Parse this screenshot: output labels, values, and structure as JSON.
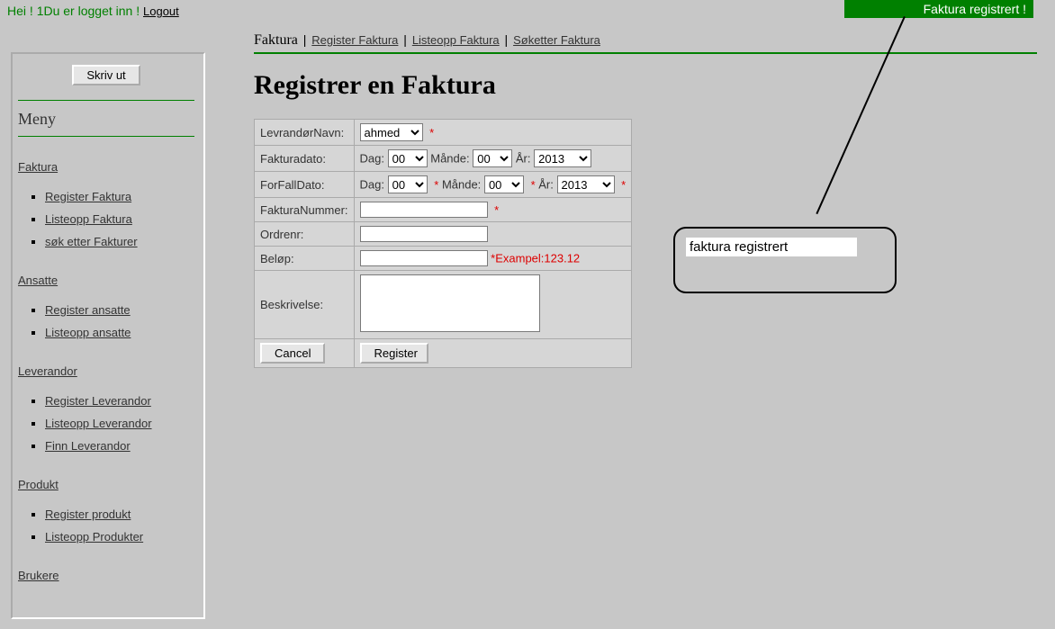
{
  "top": {
    "greet_prefix": "Hei ! ",
    "greet_user": "1",
    "greet_suffix": "Du er logget inn ! ",
    "logout": "Logout"
  },
  "banner": "Faktura registrert !",
  "sidebar": {
    "print": "Skriv ut",
    "menu_header": "Meny",
    "faktura": {
      "title": "Faktura",
      "items": [
        "Register Faktura",
        "Listeopp Faktura",
        "søk etter Fakturer"
      ]
    },
    "ansatte": {
      "title": "Ansatte",
      "items": [
        "Register ansatte",
        "Listeopp ansatte"
      ]
    },
    "leverandor": {
      "title": "Leverandor",
      "items": [
        "Register Leverandor",
        "Listeopp Leverandor",
        "Finn Leverandor"
      ]
    },
    "produkt": {
      "title": "Produkt",
      "items": [
        "Register produkt",
        "Listeopp Produkter"
      ]
    },
    "brukere": {
      "title": "Brukere"
    }
  },
  "breadcrumb": {
    "current": "Faktura",
    "links": [
      "Register Faktura",
      "Listeopp Faktura",
      "Søketter Faktura"
    ]
  },
  "page_title": "Registrer en Faktura",
  "form": {
    "labels": {
      "lev": "LevrandørNavn:",
      "fdato": "Fakturadato:",
      "ffdato": "ForFallDato:",
      "fnum": "FakturaNummer:",
      "ordre": "Ordrenr:",
      "belop": "Beløp:",
      "besk": "Beskrivelse:"
    },
    "sub": {
      "dag": "Dag:",
      "mande": "Månde:",
      "ar": "År:"
    },
    "values": {
      "lev": "ahmed",
      "dag1": "00",
      "mnd1": "00",
      "ar1": "2013",
      "dag2": "00",
      "mnd2": "00",
      "ar2": "2013",
      "fnum": "",
      "ordre": "",
      "belop": "",
      "besk": ""
    },
    "example": "*Exampel:123.12",
    "asterisk": "*",
    "buttons": {
      "cancel": "Cancel",
      "register": "Register"
    }
  },
  "callout": "faktura registrert"
}
